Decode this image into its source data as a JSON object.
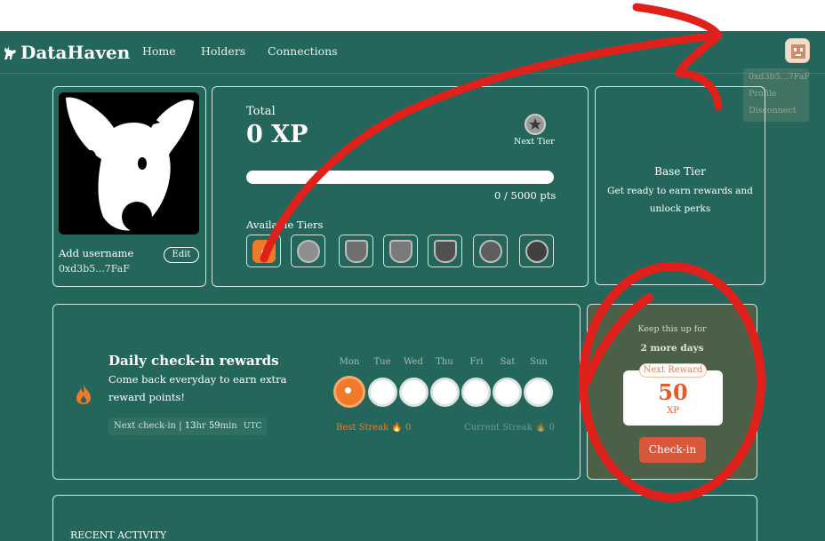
{
  "brand": {
    "name": "DataHaven"
  },
  "nav": {
    "home": "Home",
    "holders": "Holders",
    "connections": "Connections"
  },
  "account_menu": {
    "address": "0xd3b5...7FaF",
    "profile": "Profile",
    "disconnect": "Disconnect"
  },
  "profile": {
    "username": "Add username",
    "edit": "Edit",
    "address": "0xd3b5...7FaF"
  },
  "xp": {
    "total_label": "Total",
    "total_value": "0 XP",
    "next_tier": "Next Tier",
    "progress_text": "0 / 5000 pts",
    "progress_fraction": 0,
    "tiers_label": "Available Tiers",
    "current_tier_badge": "0",
    "tier_icons": [
      "flame-badge-icon",
      "star-medal-icon",
      "shield-icon",
      "crest-shield-icon",
      "banner-shield-icon",
      "round-emblem-icon",
      "winged-emblem-icon"
    ]
  },
  "tier_info": {
    "title": "Base Tier",
    "description": "Get ready to earn rewards and unlock perks"
  },
  "daily": {
    "title": "Daily check-in rewards",
    "subtitle": "Come back everyday to earn extra reward points!",
    "next_checkin_label": "Next check-in |",
    "next_checkin_hr": "13",
    "hr_unit": "hr",
    "next_checkin_min": "59",
    "min_unit": "min",
    "timezone": "UTC",
    "days": [
      "Mon",
      "Tue",
      "Wed",
      "Thu",
      "Fri",
      "Sat",
      "Sun"
    ],
    "best_streak_label": "Best Streak",
    "best_streak_value": "0",
    "current_streak_label": "Current Streak",
    "current_streak_value": "0"
  },
  "reward": {
    "keep_up": "Keep this up for",
    "more_days": "2 more days",
    "next_reward_label": "Next Reward",
    "value": "50",
    "unit": "XP",
    "button": "Check-in"
  },
  "recent": {
    "title": "RECENT ACTIVITY"
  },
  "colors": {
    "background": "#24665b",
    "accent": "#f07a2a",
    "button": "#d9573b",
    "annotation": "#e0201a"
  }
}
